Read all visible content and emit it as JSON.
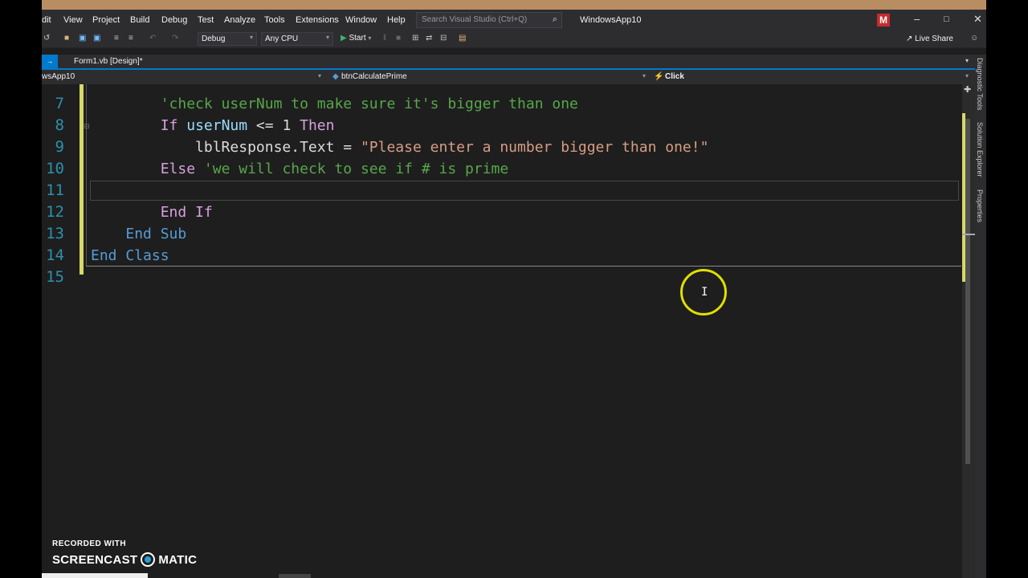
{
  "menu": {
    "items": [
      "dit",
      "View",
      "Project",
      "Build",
      "Debug",
      "Test",
      "Analyze",
      "Tools",
      "Extensions",
      "Window",
      "Help"
    ],
    "search_placeholder": "Search Visual Studio (Ctrl+Q)",
    "app_name": "WindowsApp10",
    "avatar_letter": "M"
  },
  "toolbar": {
    "config": "Debug",
    "platform": "Any CPU",
    "start_label": "Start",
    "live_share": "Live Share"
  },
  "tab": {
    "title": "Form1.vb [Design]*"
  },
  "navbar": {
    "project": "wsApp10",
    "object": "btnCalculatePrime",
    "event": "Click"
  },
  "editor": {
    "line_numbers": [
      "7",
      "8",
      "9",
      "10",
      "11",
      "12",
      "13",
      "14",
      "15"
    ],
    "lines": [
      {
        "indent": "        ",
        "parts": [
          {
            "c": "cm",
            "t": "'check userNum to make sure it's bigger than one"
          }
        ]
      },
      {
        "indent": "        ",
        "parts": [
          {
            "c": "kw",
            "t": "If"
          },
          {
            "c": "",
            "t": " "
          },
          {
            "c": "id",
            "t": "userNum"
          },
          {
            "c": "",
            "t": " <= 1 "
          },
          {
            "c": "kw",
            "t": "Then"
          }
        ]
      },
      {
        "indent": "            ",
        "parts": [
          {
            "c": "",
            "t": "lblResponse.Text = "
          },
          {
            "c": "str",
            "t": "\"Please enter a number bigger than one!\""
          }
        ]
      },
      {
        "indent": "        ",
        "parts": [
          {
            "c": "kw",
            "t": "Else"
          },
          {
            "c": "",
            "t": " "
          },
          {
            "c": "cm",
            "t": "'we will check to see if # is prime"
          }
        ]
      },
      {
        "indent": "",
        "parts": []
      },
      {
        "indent": "        ",
        "parts": [
          {
            "c": "kw",
            "t": "End If"
          }
        ]
      },
      {
        "indent": "    ",
        "parts": [
          {
            "c": "kw2",
            "t": "End Sub"
          }
        ]
      },
      {
        "indent": "",
        "parts": [
          {
            "c": "kw2",
            "t": "End Class"
          }
        ]
      },
      {
        "indent": "",
        "parts": []
      }
    ]
  },
  "side_tools": [
    "Diagnostic Tools",
    "Solution Explorer",
    "Properties"
  ],
  "watermark": {
    "recorded": "RECORDED WITH",
    "brand_left": "SCREENCAST",
    "brand_right": "MATIC"
  },
  "colors": {
    "accent": "#007acc",
    "keyword": "#d8a0df",
    "comment": "#57a64a",
    "string": "#d69d85",
    "line_number": "#2b91af"
  }
}
